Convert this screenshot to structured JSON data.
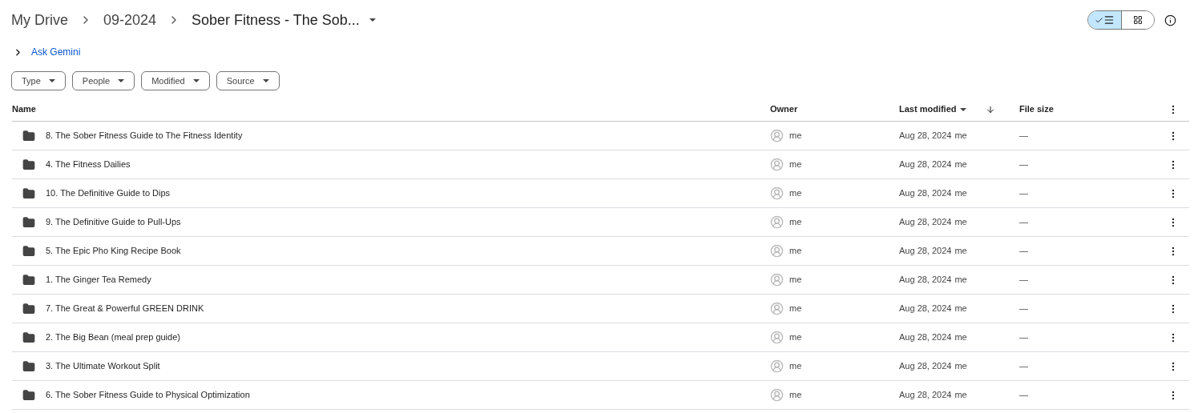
{
  "breadcrumbs": [
    {
      "label": "My Drive",
      "current": false
    },
    {
      "label": "09-2024",
      "current": false
    },
    {
      "label": "Sober Fitness - The Sob...",
      "current": true
    }
  ],
  "view_toggle": [
    {
      "kind": "list",
      "selected": true
    },
    {
      "kind": "grid",
      "selected": false
    }
  ],
  "ask_gemini": {
    "label": "Ask Gemini",
    "expanded": false
  },
  "filters": [
    "Type",
    "People",
    "Modified",
    "Source"
  ],
  "table": {
    "columns": [
      "Name",
      "Owner",
      "Last modified",
      "File size"
    ],
    "rows": [
      {
        "name": "8. The Sober Fitness Guide to The Fitness Identity",
        "owner": "me",
        "modified": "Aug 28, 2024",
        "modified_by": "me",
        "size": "—"
      },
      {
        "name": "4. The Fitness Dailies",
        "owner": "me",
        "modified": "Aug 28, 2024",
        "modified_by": "me",
        "size": "—"
      },
      {
        "name": "10. The Definitive Guide to Dips",
        "owner": "me",
        "modified": "Aug 28, 2024",
        "modified_by": "me",
        "size": "—"
      },
      {
        "name": "9. The Definitive Guide to Pull-Ups",
        "owner": "me",
        "modified": "Aug 28, 2024",
        "modified_by": "me",
        "size": "—"
      },
      {
        "name": "5. The Epic Pho King Recipe Book",
        "owner": "me",
        "modified": "Aug 28, 2024",
        "modified_by": "me",
        "size": "—"
      },
      {
        "name": "1. The Ginger Tea Remedy",
        "owner": "me",
        "modified": "Aug 28, 2024",
        "modified_by": "me",
        "size": "—"
      },
      {
        "name": "7. The Great & Powerful GREEN DRINK",
        "owner": "me",
        "modified": "Aug 28, 2024",
        "modified_by": "me",
        "size": "—"
      },
      {
        "name": "2. The Big Bean (meal prep guide)",
        "owner": "me",
        "modified": "Aug 28, 2024",
        "modified_by": "me",
        "size": "—"
      },
      {
        "name": "3. The Ultimate Workout Split",
        "owner": "me",
        "modified": "Aug 28, 2024",
        "modified_by": "me",
        "size": "—"
      },
      {
        "name": "6. The Sober Fitness Guide to Physical Optimization",
        "owner": "me",
        "modified": "Aug 28, 2024",
        "modified_by": "me",
        "size": "—"
      }
    ]
  }
}
